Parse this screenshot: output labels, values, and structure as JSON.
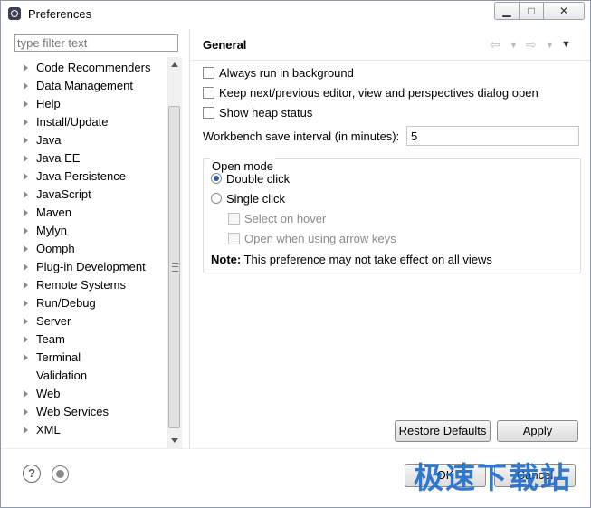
{
  "window": {
    "title": "Preferences"
  },
  "filter": {
    "placeholder": "type filter text"
  },
  "tree": [
    {
      "label": "Code Recommenders",
      "expandable": true
    },
    {
      "label": "Data Management",
      "expandable": true
    },
    {
      "label": "Help",
      "expandable": true
    },
    {
      "label": "Install/Update",
      "expandable": true
    },
    {
      "label": "Java",
      "expandable": true
    },
    {
      "label": "Java EE",
      "expandable": true
    },
    {
      "label": "Java Persistence",
      "expandable": true
    },
    {
      "label": "JavaScript",
      "expandable": true
    },
    {
      "label": "Maven",
      "expandable": true
    },
    {
      "label": "Mylyn",
      "expandable": true
    },
    {
      "label": "Oomph",
      "expandable": true
    },
    {
      "label": "Plug-in Development",
      "expandable": true
    },
    {
      "label": "Remote Systems",
      "expandable": true
    },
    {
      "label": "Run/Debug",
      "expandable": true
    },
    {
      "label": "Server",
      "expandable": true
    },
    {
      "label": "Team",
      "expandable": true
    },
    {
      "label": "Terminal",
      "expandable": true
    },
    {
      "label": "Validation",
      "expandable": false
    },
    {
      "label": "Web",
      "expandable": true
    },
    {
      "label": "Web Services",
      "expandable": true
    },
    {
      "label": "XML",
      "expandable": true
    }
  ],
  "page": {
    "title": "General",
    "options": {
      "always_run": {
        "label": "Always run in background",
        "checked": false
      },
      "keep_next_prev": {
        "label": "Keep next/previous editor, view and perspectives dialog open",
        "checked": false
      },
      "show_heap": {
        "label": "Show heap status",
        "checked": false
      }
    },
    "interval": {
      "label": "Workbench save interval (in minutes):",
      "value": "5"
    },
    "open_mode": {
      "legend": "Open mode",
      "double_click": "Double click",
      "single_click": "Single click",
      "select_on_hover": "Select on hover",
      "open_arrow_keys": "Open when using arrow keys",
      "selected": "double_click"
    },
    "note": {
      "bold": "Note:",
      "text": " This preference may not take effect on all views"
    },
    "restore_defaults": "Restore Defaults",
    "apply": "Apply"
  },
  "footer": {
    "ok": "OK",
    "cancel": "Cancel",
    "help_icon": "help-icon",
    "stop_icon": "stop-icon"
  },
  "watermark": "极速下载站",
  "colors": {
    "accent": "#2a5aa8",
    "watermark": "#1f6fcc"
  }
}
